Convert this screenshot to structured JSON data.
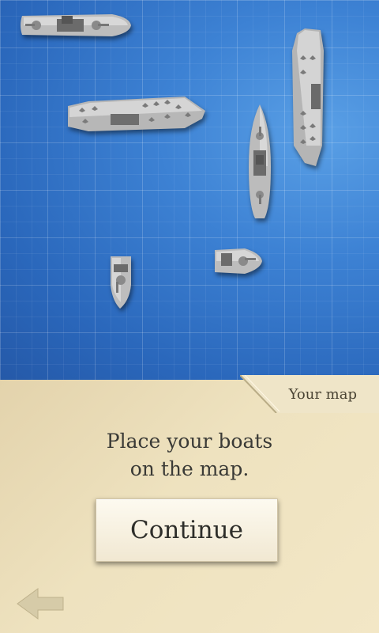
{
  "map": {
    "boats": [
      {
        "name": "battleship",
        "orientation": "horizontal"
      },
      {
        "name": "aircraft-carrier",
        "orientation": "horizontal"
      },
      {
        "name": "aircraft-carrier",
        "orientation": "vertical"
      },
      {
        "name": "cruiser",
        "orientation": "vertical"
      },
      {
        "name": "patrol-boat",
        "orientation": "horizontal"
      },
      {
        "name": "patrol-boat",
        "orientation": "vertical"
      }
    ]
  },
  "panel": {
    "tab_label": "Your map",
    "instruction_line1": "Place your boats",
    "instruction_line2": "on the map.",
    "continue_label": "Continue"
  },
  "icons": {
    "back": "back-arrow-icon"
  },
  "colors": {
    "sea": "#3d82d4",
    "panel": "#eee2bf",
    "hull": "#c9c9c9"
  }
}
